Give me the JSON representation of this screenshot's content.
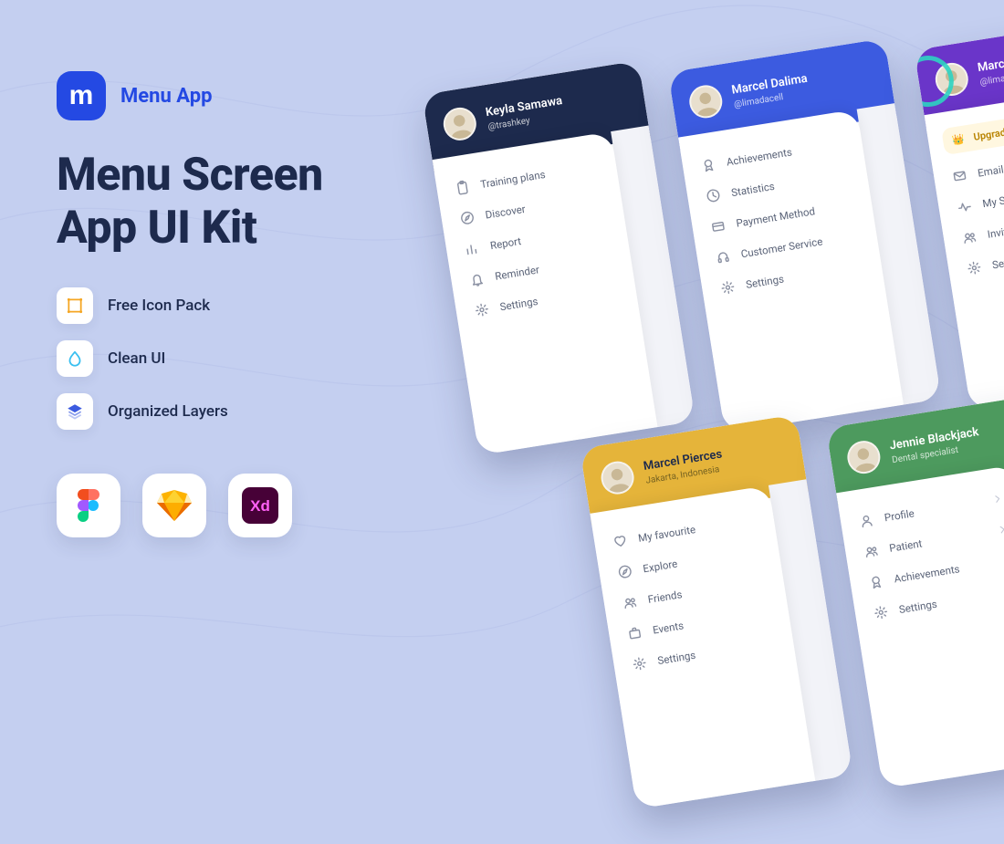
{
  "brand": {
    "logo_glyph": "m",
    "name": "Menu App"
  },
  "headline": "Menu Screen\nApp UI Kit",
  "features": [
    {
      "label": "Free Icon Pack",
      "icon": "icon-pack",
      "color": "#f5a623"
    },
    {
      "label": "Clean UI",
      "icon": "droplet",
      "color": "#39bff0"
    },
    {
      "label": "Organized Layers",
      "icon": "layers",
      "color": "#3c5be0"
    }
  ],
  "tools": [
    {
      "name": "Figma"
    },
    {
      "name": "Sketch"
    },
    {
      "name": "Adobe XD"
    }
  ],
  "phones": {
    "navy": {
      "user_name": "Keyla Samawa",
      "user_sub": "@trashkey",
      "items": [
        {
          "label": "Training plans",
          "icon": "clipboard"
        },
        {
          "label": "Discover",
          "icon": "compass"
        },
        {
          "label": "Report",
          "icon": "bar-chart"
        },
        {
          "label": "Reminder",
          "icon": "bell"
        },
        {
          "label": "Settings",
          "icon": "gear"
        }
      ]
    },
    "blue": {
      "user_name": "Marcel Dalima",
      "user_sub": "@limadacell",
      "items": [
        {
          "label": "Achievements",
          "icon": "medal"
        },
        {
          "label": "Statistics",
          "icon": "clock"
        },
        {
          "label": "Payment Method",
          "icon": "card"
        },
        {
          "label": "Customer Service",
          "icon": "headset"
        },
        {
          "label": "Settings",
          "icon": "gear"
        }
      ]
    },
    "purple": {
      "user_name": "Marcel Dalima",
      "user_sub": "@limadacell",
      "upgrade_label": "Upgrade to Pro",
      "items": [
        {
          "label": "Email",
          "icon": "mail"
        },
        {
          "label": "My Statistics",
          "icon": "activity"
        },
        {
          "label": "Invite Friends",
          "icon": "users"
        },
        {
          "label": "Settings",
          "icon": "gear"
        }
      ]
    },
    "yellow": {
      "user_name": "Marcel Pierces",
      "user_sub": "Jakarta, Indonesia",
      "items": [
        {
          "label": "My favourite",
          "icon": "heart"
        },
        {
          "label": "Explore",
          "icon": "compass"
        },
        {
          "label": "Friends",
          "icon": "users"
        },
        {
          "label": "Events",
          "icon": "briefcase"
        },
        {
          "label": "Settings",
          "icon": "gear"
        }
      ]
    },
    "green": {
      "user_name": "Jennie Blackjack",
      "user_sub": "Dental specialist",
      "items": [
        {
          "label": "Profile",
          "icon": "user"
        },
        {
          "label": "Patient",
          "icon": "users"
        },
        {
          "label": "Achievements",
          "icon": "medal"
        },
        {
          "label": "Settings",
          "icon": "gear"
        }
      ]
    }
  }
}
